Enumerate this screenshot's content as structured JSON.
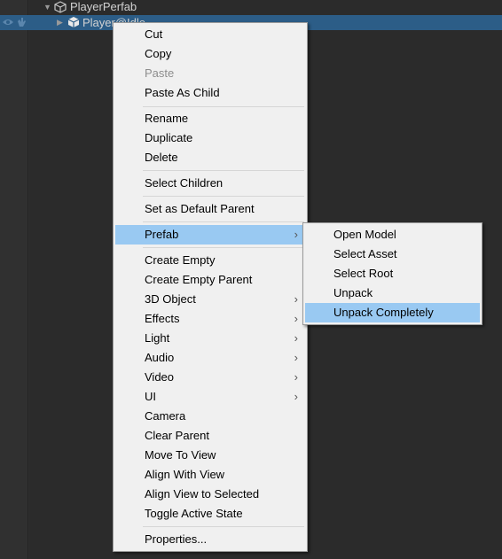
{
  "hierarchy": {
    "root": {
      "label": "PlayerPerfab"
    },
    "selected": {
      "label": "Player@Idle"
    }
  },
  "context_menu": {
    "cut": "Cut",
    "copy": "Copy",
    "paste": "Paste",
    "paste_as_child": "Paste As Child",
    "rename": "Rename",
    "duplicate": "Duplicate",
    "delete": "Delete",
    "select_children": "Select Children",
    "set_default_parent": "Set as Default Parent",
    "prefab": "Prefab",
    "create_empty": "Create Empty",
    "create_empty_parent": "Create Empty Parent",
    "object_3d": "3D Object",
    "effects": "Effects",
    "light": "Light",
    "audio": "Audio",
    "video": "Video",
    "ui": "UI",
    "camera": "Camera",
    "clear_parent": "Clear Parent",
    "move_to_view": "Move To View",
    "align_with_view": "Align With View",
    "align_view_to_selected": "Align View to Selected",
    "toggle_active_state": "Toggle Active State",
    "properties": "Properties..."
  },
  "submenu_arrow": "›",
  "prefab_submenu": {
    "open_model": "Open Model",
    "select_asset": "Select Asset",
    "select_root": "Select Root",
    "unpack": "Unpack",
    "unpack_completely": "Unpack Completely"
  },
  "icons": {
    "foldout_open": "▼",
    "foldout_closed": "▶"
  },
  "colors": {
    "panel_bg": "#2b2b2b",
    "selection_row": "#2c5d87",
    "menu_bg": "#f0f0f0",
    "menu_highlight": "#99c9f2",
    "disabled_text": "#8d8d8d"
  }
}
